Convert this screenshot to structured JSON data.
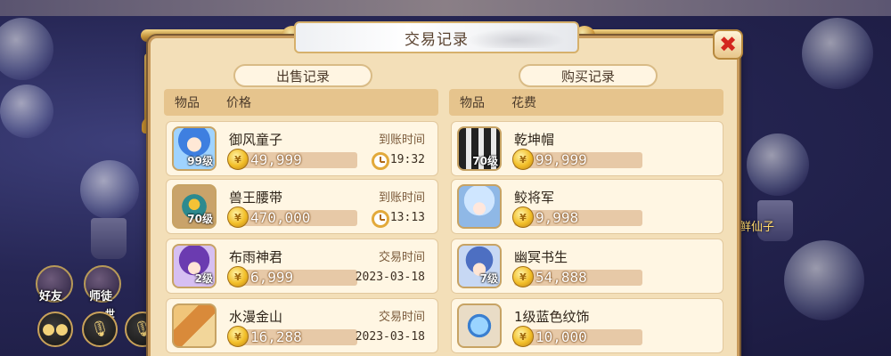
{
  "dialog": {
    "title": "交易记录",
    "close_icon": "close-icon"
  },
  "sell": {
    "section_title": "出售记录",
    "headers": {
      "item": "物品",
      "price": "价格"
    },
    "rows": [
      {
        "name": "御风童子",
        "level": "99级",
        "price": "49,999",
        "time_label": "到账时间",
        "time": "19:32",
        "icon": "clock-icon"
      },
      {
        "name": "兽王腰带",
        "level": "70级",
        "price": "470,000",
        "time_label": "到账时间",
        "time": "13:13",
        "icon": "clock-icon"
      },
      {
        "name": "布雨神君",
        "level": "2级",
        "price": "6,999",
        "time_label": "交易时间",
        "time": "2023-03-18"
      },
      {
        "name": "水漫金山",
        "level": "",
        "price": "16,288",
        "time_label": "交易时间",
        "time": "2023-03-18"
      }
    ]
  },
  "buy": {
    "section_title": "购买记录",
    "headers": {
      "item": "物品",
      "cost": "花费"
    },
    "rows": [
      {
        "name": "乾坤帽",
        "level": "70级",
        "price": "99,999"
      },
      {
        "name": "鲛将军",
        "level": "",
        "price": "9,998"
      },
      {
        "name": "幽冥书生",
        "level": "7级",
        "price": "54,888"
      },
      {
        "name": "1级蓝色纹饰",
        "level": "",
        "price": "10,000"
      }
    ]
  },
  "hud": {
    "friends_label": "好友",
    "master_label": "师徒",
    "world_label": "世",
    "npc_name": "鲜仙子"
  },
  "colors": {
    "panel_bg": "#f3dfb8",
    "close_red": "#d3261f",
    "coin_gold": "#f2be28"
  }
}
